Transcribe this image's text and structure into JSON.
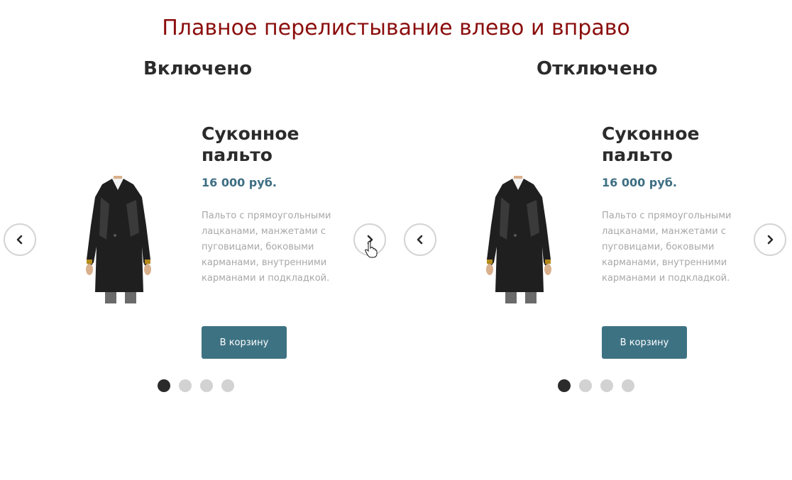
{
  "page": {
    "title": "Плавное перелистывание влево и вправо"
  },
  "demos": [
    {
      "heading": "Включено",
      "product": {
        "name": "Суконное пальто",
        "price": "16 000 руб.",
        "description": "Пальто с прямоугольными лацканами, манжетами с пуговицами, боковыми карманами, внутренними карманами и подкладкой.",
        "image_icon": "coat-image"
      },
      "cart_button_label": "В корзину",
      "prev_icon": "chevron-left-icon",
      "next_icon": "chevron-right-icon",
      "dots": {
        "count": 4,
        "active_index": 0
      },
      "hover_cursor": "hand-pointer-icon"
    },
    {
      "heading": "Отключено",
      "product": {
        "name": "Суконное пальто",
        "price": "16 000 руб.",
        "description": "Пальто с прямоугольными лацканами, манжетами с пуговицами, боковыми карманами, внутренними карманами и подкладкой.",
        "image_icon": "coat-image"
      },
      "cart_button_label": "В корзину",
      "prev_icon": "chevron-left-icon",
      "next_icon": "chevron-right-icon",
      "dots": {
        "count": 4,
        "active_index": 0
      }
    }
  ],
  "colors": {
    "title": "#8b0d0d",
    "heading": "#2b2b2b",
    "price": "#3e6f84",
    "description": "#a8a8a8",
    "button_bg": "#3d7283",
    "button_text": "#ffffff",
    "dot_active": "#2b2b2b",
    "dot_inactive": "#d2d2d2",
    "arrow_border": "#d4d4d4"
  }
}
